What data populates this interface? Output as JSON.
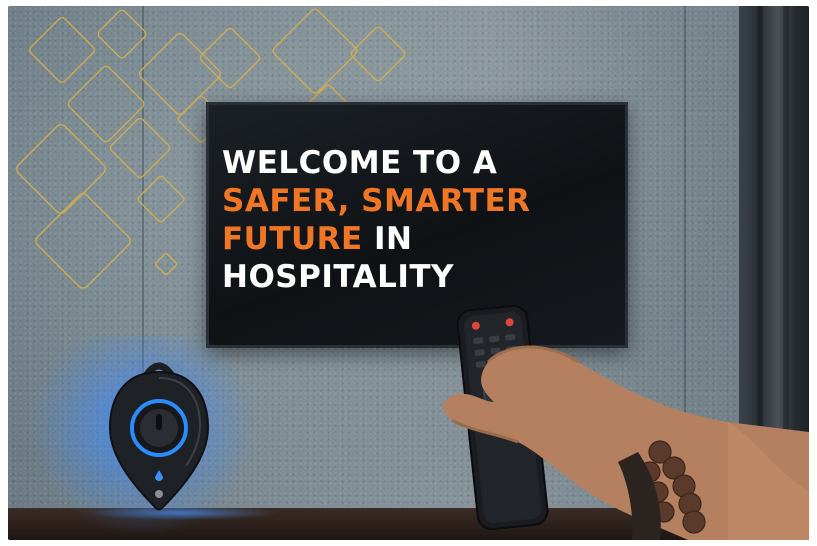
{
  "headline": {
    "line1": "WELCOME TO A",
    "line2": "SAFER, SMARTER",
    "line3_accent": "FUTURE",
    "line3_rest": " IN",
    "line4": "HOSPITALITY"
  },
  "colors": {
    "accent": "#f07524",
    "headline_white": "#ffffff",
    "diamond_gold": "#d9b24a",
    "beacon_glow": "#3c8cff"
  },
  "icons": {
    "beacon": "safety-beacon-device",
    "remote": "tv-remote-control"
  }
}
